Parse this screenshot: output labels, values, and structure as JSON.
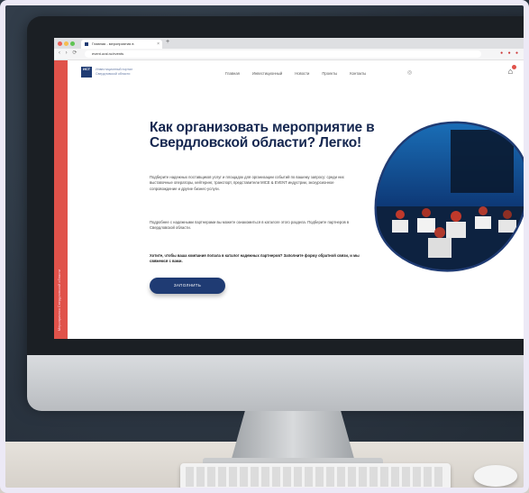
{
  "browser": {
    "tab_title": "Главная - мероприятия в",
    "tab_close": "×",
    "new_tab": "+",
    "nav_arrows": "‹ › ⟳",
    "url": "event.ural.ru/events",
    "ext_icons": "● ● ●"
  },
  "site": {
    "logo_mark": "ИСТ",
    "logo_text": "Инвестиционный портал Свердловской области",
    "nav": [
      "Главная",
      "Инвестиционный",
      "Новости",
      "Проекты",
      "Контакты"
    ],
    "header_icon": "◎",
    "cart_icon": "⌂",
    "sidebar_label": "Мероприятия Свердловской области",
    "hero_title": "Как организовать мероприятие в Свердловской области? Легко!",
    "para1": "Подберите надежных поставщиков услуг и площадок для организации событий по вашему запросу: среди них выставочные операторы, кейтеринг, транспорт, представители MICE & EVENT индустрии, экскурсионное сопровождение и другие бизнес-услуги.",
    "para2": "Подробнее с надежными партнерами вы можете ознакомиться в каталоге этого раздела. Подберите партнеров в Свердловской области.",
    "para3": "Хотите, чтобы ваша компания попала в каталог надежных партнеров? Заполните форму обратной связи, и мы свяжемся с вами.",
    "cta_label": "ЗАПОЛНИТЬ"
  },
  "colors": {
    "brand_navy": "#14264f",
    "accent_red": "#e0524a",
    "button": "#1f3b73"
  }
}
